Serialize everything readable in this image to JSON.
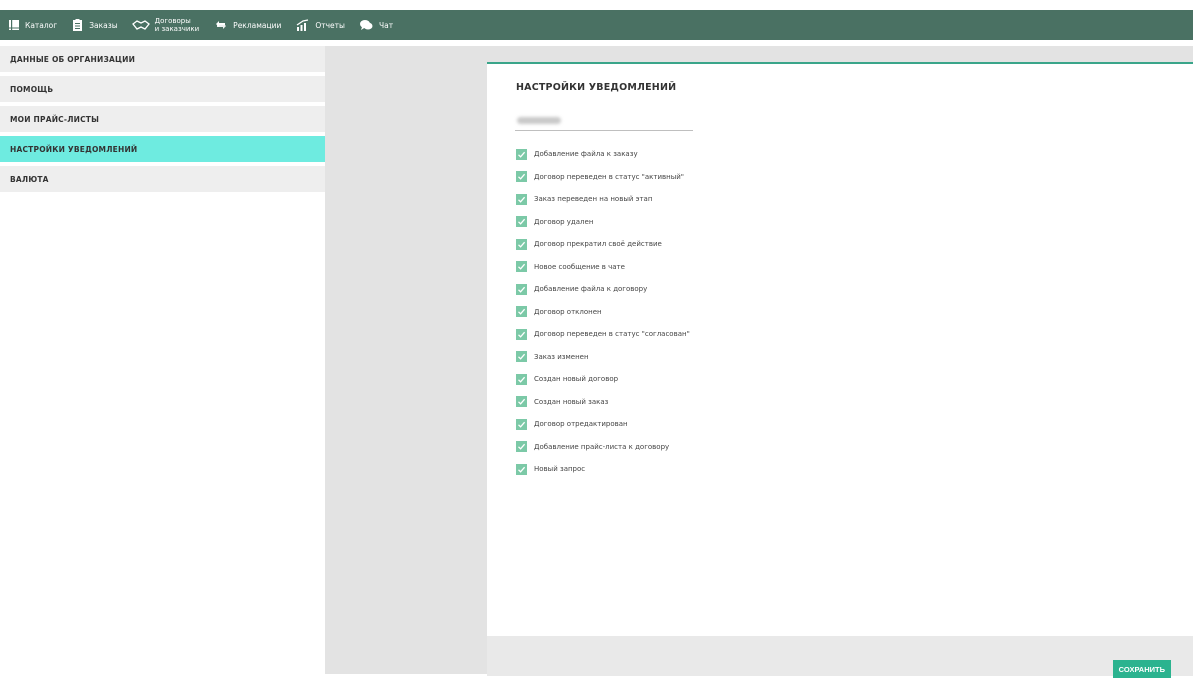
{
  "nav": {
    "items": [
      {
        "label": "Каталог",
        "icon": "catalog-icon"
      },
      {
        "label": "Заказы",
        "icon": "orders-icon"
      },
      {
        "label_line1": "Договоры",
        "label_line2": "и заказчики",
        "icon": "handshake-icon"
      },
      {
        "label": "Рекламации",
        "icon": "claims-icon"
      },
      {
        "label": "Отчеты",
        "icon": "reports-icon"
      },
      {
        "label": "Чат",
        "icon": "chat-icon"
      }
    ]
  },
  "sidebar": {
    "items": [
      {
        "label": "ДАННЫЕ ОБ ОРГАНИЗАЦИИ"
      },
      {
        "label": "ПОМОЩЬ"
      },
      {
        "label": "МОИ ПРАЙС-ЛИСТЫ"
      },
      {
        "label": "НАСТРОЙКИ УВЕДОМЛЕНИЙ",
        "active": true
      },
      {
        "label": "ВАЛЮТА"
      }
    ]
  },
  "panel": {
    "title": "НАСТРОЙКИ УВЕДОМЛЕНИЙ",
    "options": [
      {
        "label": "Добавление файла к заказу",
        "checked": true
      },
      {
        "label": "Договор переведен в статус \"активный\"",
        "checked": true
      },
      {
        "label": "Заказ переведен на новый этап",
        "checked": true
      },
      {
        "label": "Договор удален",
        "checked": true
      },
      {
        "label": "Договор прекратил своё действие",
        "checked": true
      },
      {
        "label": "Новое сообщение в чате",
        "checked": true
      },
      {
        "label": "Добавление файла к договору",
        "checked": true
      },
      {
        "label": "Договор отклонен",
        "checked": true
      },
      {
        "label": "Договор переведен в статус \"согласован\"",
        "checked": true
      },
      {
        "label": "Заказ изменен",
        "checked": true
      },
      {
        "label": "Создан новый договор",
        "checked": true
      },
      {
        "label": "Создан новый заказ",
        "checked": true
      },
      {
        "label": "Договор отредактирован",
        "checked": true
      },
      {
        "label": "Добавление прайс-листа к договору",
        "checked": true
      },
      {
        "label": "Новый запрос",
        "checked": true
      }
    ],
    "save_label": "СОХРАНИТЬ"
  },
  "colors": {
    "topbar": "#4a7163",
    "active_sidebar": "#6eebe0",
    "checkbox": "#7cc9a7",
    "accent": "#2bb38f"
  }
}
